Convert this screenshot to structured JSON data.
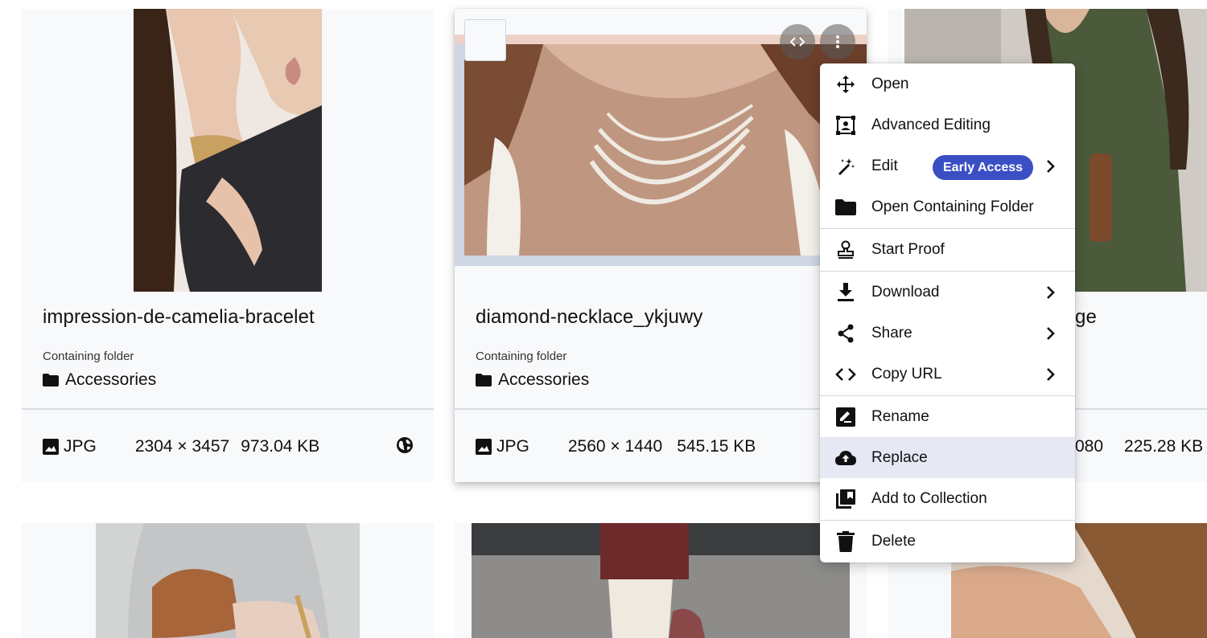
{
  "cards": [
    {
      "title": "impression-de-camelia-bracelet",
      "folder_label": "Containing folder",
      "folder": "Accessories",
      "type": "JPG",
      "dimensions": "2304 × 3457",
      "size": "973.04 KB",
      "visibility_icon": "globe-icon"
    },
    {
      "title": "diamond-necklace_ykjuwy",
      "folder_label": "Containing folder",
      "folder": "Accessories",
      "type": "JPG",
      "dimensions": "2560 × 1440",
      "size": "545.15 KB"
    },
    {
      "title_fragment": "ge",
      "dimensions_fragment": "080",
      "size": "225.28 KB"
    }
  ],
  "menu": {
    "items": [
      {
        "label": "Open",
        "icon": "move-arrows-icon"
      },
      {
        "label": "Advanced Editing",
        "icon": "face-frame-icon"
      },
      {
        "label": "Edit",
        "icon": "magic-wand-icon",
        "badge": "Early Access",
        "submenu": true
      },
      {
        "label": "Open Containing Folder",
        "icon": "folder-icon"
      },
      {
        "label": "Start Proof",
        "icon": "stamp-icon"
      },
      {
        "label": "Download",
        "icon": "download-icon",
        "submenu": true
      },
      {
        "label": "Share",
        "icon": "share-icon",
        "submenu": true
      },
      {
        "label": "Copy URL",
        "icon": "code-icon",
        "submenu": true
      },
      {
        "label": "Rename",
        "icon": "rename-icon"
      },
      {
        "label": "Replace",
        "icon": "cloud-upload-icon",
        "highlighted": true
      },
      {
        "label": "Add to Collection",
        "icon": "collection-icon"
      },
      {
        "label": "Delete",
        "icon": "trash-icon"
      }
    ]
  },
  "colors": {
    "badge": "#3b4fc4",
    "highlight": "#e6e8f3",
    "card_bg": "#f8f9fb"
  }
}
